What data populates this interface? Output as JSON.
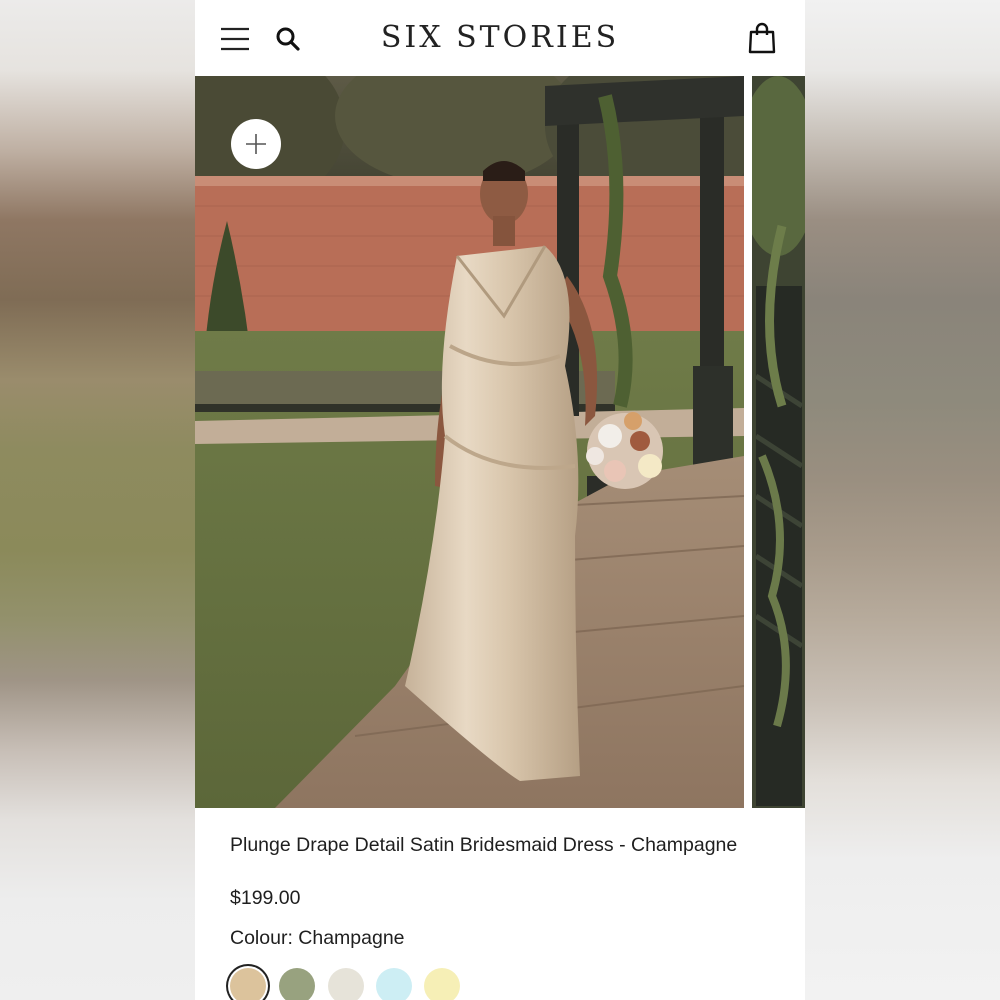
{
  "header": {
    "brand": "SIX STORIES",
    "menu_icon": "hamburger-menu-icon",
    "search_icon": "search-icon",
    "bag_icon": "shopping-bag-icon"
  },
  "gallery": {
    "zoom_icon": "plus-icon",
    "images": [
      "product-photo-1",
      "product-photo-2"
    ]
  },
  "product": {
    "title": "Plunge Drape Detail Satin Bridesmaid Dress - Champagne",
    "price": "$199.00",
    "colour_label": "Colour: Champagne",
    "swatches": [
      {
        "name": "Champagne",
        "color": "#dcc39c",
        "selected": true
      },
      {
        "name": "Sage",
        "color": "#98a27f",
        "selected": false
      },
      {
        "name": "Ivory",
        "color": "#e6e3d9",
        "selected": false
      },
      {
        "name": "Sky",
        "color": "#cdeef4",
        "selected": false
      },
      {
        "name": "Lemon",
        "color": "#f6efb6",
        "selected": false
      }
    ]
  },
  "colors": {
    "text": "#1f1f1f",
    "background": "#ffffff"
  }
}
